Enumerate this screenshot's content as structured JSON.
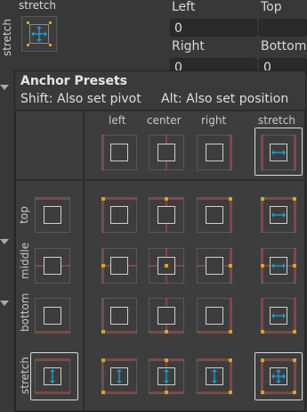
{
  "inspector": {
    "stretch_top_label": "stretch",
    "stretch_side_label": "stretch",
    "left_label": "Left",
    "top_label": "Top",
    "left_value": "0",
    "top_value": "",
    "right_label": "Right",
    "bottom_label": "Bottom",
    "right_value": "0",
    "bottom_value": "0"
  },
  "popup": {
    "title": "Anchor Presets",
    "shift_hint": "Shift: Also set pivot",
    "alt_hint": "Alt: Also set position",
    "columns": [
      "left",
      "center",
      "right",
      "stretch"
    ],
    "rows": [
      "top",
      "middle",
      "bottom",
      "stretch"
    ]
  },
  "colors": {
    "anchor_line": "#c8504b",
    "anchor_dot": "#e0a021",
    "stretch_accent": "#1f9bd0"
  }
}
